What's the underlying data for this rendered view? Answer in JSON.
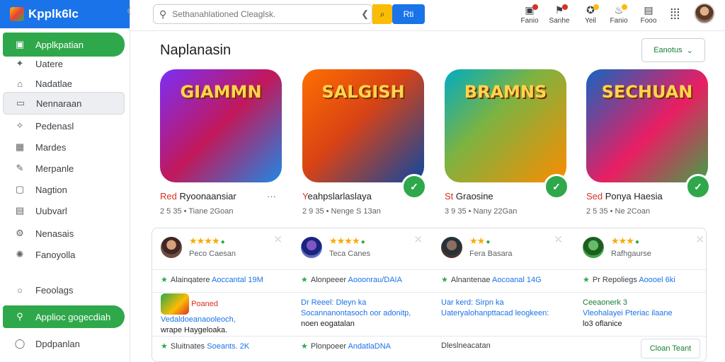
{
  "app": {
    "title": "Kpplk6lc"
  },
  "sidebar": {
    "items": [
      {
        "label": "Applkpatian",
        "icon": "app-icon",
        "glyph": "▣",
        "state": "active"
      },
      {
        "label": "Uatere",
        "icon": "sparkle-icon",
        "glyph": "✦",
        "state": ""
      },
      {
        "label": "Nadatlae",
        "icon": "home-icon",
        "glyph": "⌂",
        "state": ""
      },
      {
        "label": "Nennaraan",
        "icon": "rectangle-icon",
        "glyph": "▭",
        "state": "highlight"
      },
      {
        "label": "Pedenasl",
        "icon": "star-icon",
        "glyph": "✧",
        "state": ""
      },
      {
        "label": "Mardes",
        "icon": "grid-icon",
        "glyph": "▦",
        "state": ""
      },
      {
        "label": "Merpanle",
        "icon": "edit-icon",
        "glyph": "✎",
        "state": ""
      },
      {
        "label": "Nagtion",
        "icon": "image-icon",
        "glyph": "▢",
        "state": ""
      },
      {
        "label": "Uubvarl",
        "icon": "document-icon",
        "glyph": "▤",
        "state": ""
      },
      {
        "label": "Nenasais",
        "icon": "settings-icon",
        "glyph": "⚙",
        "state": ""
      },
      {
        "label": "Fanoyolla",
        "icon": "bulb-icon",
        "glyph": "✺",
        "state": ""
      },
      {
        "label": "Feoolags",
        "icon": "circle-icon",
        "glyph": "○",
        "state": ""
      },
      {
        "label": "Applioc gogecdiah",
        "icon": "search-icon",
        "glyph": "⚲",
        "state": "active"
      },
      {
        "label": "Dpdpanlan",
        "icon": "user-icon",
        "glyph": "◯",
        "state": ""
      }
    ]
  },
  "topbar": {
    "search_placeholder": "Sethanahlationed Cleaglsk.",
    "search_button": "⌕",
    "blue_button": "Rti",
    "actions": [
      {
        "label": "Fanio",
        "icon": "calendar-icon",
        "glyph": "▣",
        "badge": "#d93025"
      },
      {
        "label": "Sanhe",
        "icon": "flag-icon",
        "glyph": "⚑",
        "badge": "#d93025"
      },
      {
        "label": "Yeil",
        "icon": "puzzle-icon",
        "glyph": "✪",
        "badge": "#fbbc04"
      },
      {
        "label": "Fanio",
        "icon": "gift-icon",
        "glyph": "♨",
        "badge": "#fbbc04"
      },
      {
        "label": "Fooo",
        "icon": "briefcase-icon",
        "glyph": "▤",
        "badge": ""
      }
    ]
  },
  "main": {
    "title": "Naplanasin",
    "sort_label": "Eanotus",
    "cards": [
      {
        "thumb_text": "GIAMMN",
        "title_red": "Red",
        "title_rest": " Ryoonaansiar",
        "sub": "2 5 35 • Tiane 2Goan",
        "bg": "linear-gradient(135deg,#7b2ff7 0%,#c2185b 50%,#1e88e5 100%)"
      },
      {
        "thumb_text": "SALGISH",
        "title_red": "Y",
        "title_rest": "eahpslarlaslaya",
        "sub": "2 9 35 • Nenge S 13an",
        "bg": "linear-gradient(135deg,#ff6f00 0%,#d84315 45%,#0d47a1 100%)"
      },
      {
        "thumb_text": "BRAMNS",
        "title_red": "St",
        "title_rest": " Graosine",
        "sub": "3 9 35 • Nany 22Gan",
        "bg": "linear-gradient(135deg,#00acc1 0%,#7cb342 40%,#fb8c00 100%)"
      },
      {
        "thumb_text": "SECHUAN",
        "title_red": "Sed",
        "title_rest": " Ponya Haesia",
        "sub": "2 5 35 • Ne 2Coan",
        "bg": "linear-gradient(135deg,#1565c0 0%,#e91e63 55%,#43a047 100%)"
      }
    ],
    "reviews": [
      {
        "stars": "★★★★",
        "name": "Peco Caesan",
        "avatar": "radial-gradient(circle at 50% 38%, #d7a07a 0 28%, #3e2723 29% 55%, #6d4c41 56%)"
      },
      {
        "stars": "★★★★",
        "name": "Teca Canes",
        "avatar": "radial-gradient(circle at 50% 40%, #7e57c2 0 30%, #1a237e 31% 60%, #5c6bc0 61%)"
      },
      {
        "stars": "★★",
        "name": "Fera Basara",
        "avatar": "radial-gradient(circle at 50% 40%, #8d6e63 0 30%, #263238 31% 60%, #4e342e 61%)"
      },
      {
        "stars": "★★★",
        "name": "Rafhgaurse",
        "avatar": "radial-gradient(circle at 50% 40%, #66bb6a 0 30%, #1b5e20 31% 60%, #43a047 61%)"
      }
    ],
    "links_row1": [
      {
        "label": "Alainqatere",
        "link": "Aoccantal 19M"
      },
      {
        "label": "Alonpeeer",
        "link": "Aooonrau/DAIA"
      },
      {
        "label": "Alnantenae",
        "link": "Aocoanal 14G"
      },
      {
        "label": "Pr Repoliegs",
        "link": "Aoooel 6ki"
      }
    ],
    "descriptions": [
      {
        "line1": "Poaned",
        "line2": "Vedaldoeanaooleoch,",
        "line3": "wrape Haygeloaka."
      },
      {
        "line1": "Dr Reeel: Dleyn ka",
        "line2": "Socannanontasoch oor adonitp,",
        "line3": "noen eogatalan"
      },
      {
        "line1": "Uar kerd: Sirpn ka",
        "line2": "Uateryalohanpttacad leogkeen:",
        "line3": ""
      },
      {
        "line1": "Ceeaonerk 3",
        "line2": "Vleohalayei Pteriac ilaane",
        "line3": "lo3 oflanice"
      }
    ],
    "links_row2": [
      {
        "label": "Sluitnates",
        "link": "Soeants. 2K"
      },
      {
        "label": "Plonpoeer",
        "link": "AndatlaDNA"
      },
      {
        "label": "Dleslneacatan",
        "link": ""
      }
    ],
    "open_button": "Cloan Teant"
  },
  "colors": {
    "accent_green": "#2ea84a",
    "brand_blue": "#1a73e8",
    "star": "#f9ab00"
  }
}
